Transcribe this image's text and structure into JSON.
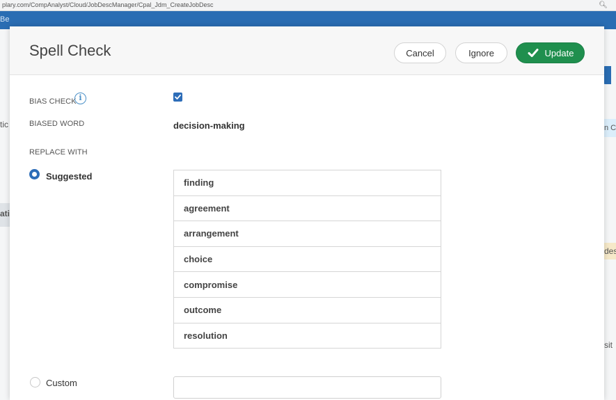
{
  "browser": {
    "url": "plary.com/CompAnalyst/Cloud/JobDescManager/Cpal_Jdm_CreateJobDesc",
    "zoom_icon": "magnifier-icon"
  },
  "background": {
    "header_text": "Be",
    "fragments": [
      "tic",
      "ati",
      "n Co",
      "des",
      "sit"
    ]
  },
  "modal": {
    "title": "Spell Check",
    "buttons": {
      "cancel": "Cancel",
      "ignore": "Ignore",
      "update": "Update"
    },
    "bias_check": {
      "label": "BIAS CHECK",
      "info_icon": "i",
      "checked": true
    },
    "biased_word": {
      "label": "BIASED WORD",
      "value": "decision-making"
    },
    "replace_with": {
      "label": "REPLACE WITH",
      "suggested_label": "Suggested",
      "custom_label": "Custom",
      "selected": "Suggested",
      "suggestions": [
        "finding",
        "agreement",
        "arrangement",
        "choice",
        "compromise",
        "outcome",
        "resolution"
      ],
      "custom_value": ""
    },
    "colors": {
      "accent": "#2d6db8",
      "update_button": "#1f8f4e"
    }
  }
}
